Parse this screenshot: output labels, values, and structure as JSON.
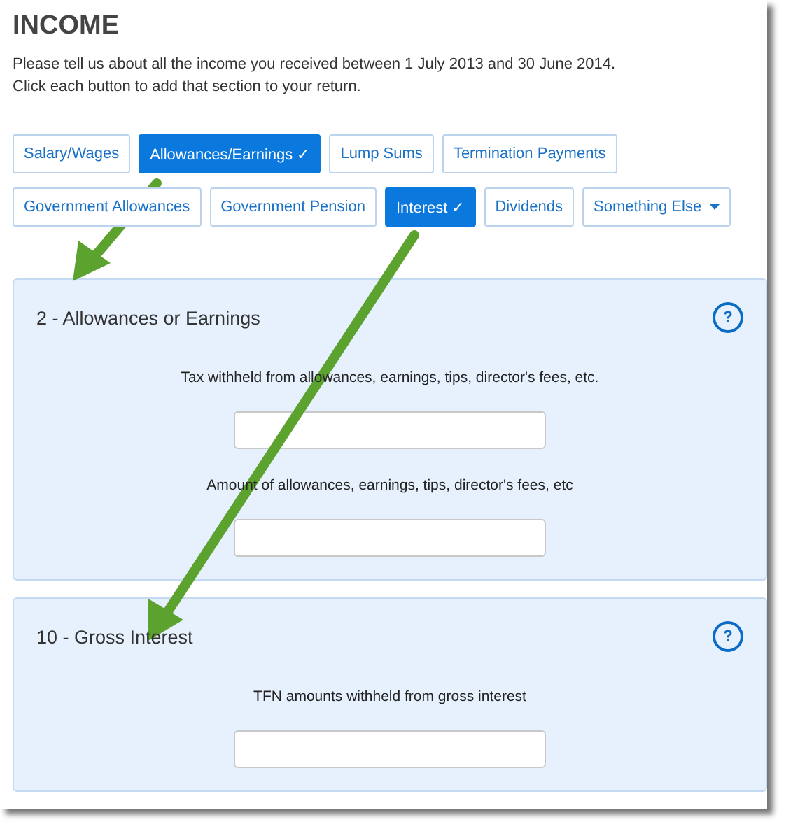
{
  "title": "INCOME",
  "intro": [
    "Please tell us about all the income you received between 1 July 2013 and 30 June 2014.",
    "Click each button to add that section to your return."
  ],
  "button_rows": [
    [
      {
        "label": "Salary/Wages",
        "selected": false,
        "kind": "toggle"
      },
      {
        "label": "Allowances/Earnings ✓",
        "selected": true,
        "kind": "toggle"
      },
      {
        "label": "Lump Sums",
        "selected": false,
        "kind": "toggle"
      },
      {
        "label": "Termination Payments",
        "selected": false,
        "kind": "toggle"
      }
    ],
    [
      {
        "label": "Government Allowances",
        "selected": false,
        "kind": "toggle"
      },
      {
        "label": "Government Pension",
        "selected": false,
        "kind": "toggle"
      },
      {
        "label": "Interest ✓",
        "selected": true,
        "kind": "toggle"
      },
      {
        "label": "Dividends",
        "selected": false,
        "kind": "toggle"
      },
      {
        "label": "Something Else",
        "selected": false,
        "kind": "dropdown"
      }
    ]
  ],
  "sections": [
    {
      "title": "2 - Allowances or Earnings",
      "help": "?",
      "fields": [
        {
          "label": "Tax withheld from allowances, earnings, tips, director's fees, etc."
        },
        {
          "label": "Amount of allowances, earnings, tips, director's fees, etc"
        }
      ]
    },
    {
      "title": "10 - Gross Interest",
      "help": "?",
      "fields": [
        {
          "label": "TFN amounts withheld from gross interest"
        }
      ]
    }
  ]
}
